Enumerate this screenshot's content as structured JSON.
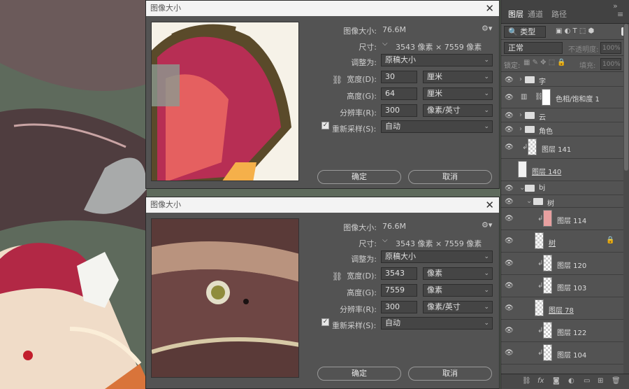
{
  "dialogs": [
    {
      "title": "图像大小",
      "image_size_label": "图像大小:",
      "image_size_value": "76.6M",
      "dimensions_label": "尺寸:",
      "dimensions_value": "3543 像素 × 7559 像素",
      "fit_label": "调整为:",
      "fit_value": "原稿大小",
      "width_label": "宽度(D):",
      "width_value": "30",
      "width_unit": "厘米",
      "height_label": "高度(G):",
      "height_value": "64",
      "height_unit": "厘米",
      "res_label": "分辨率(R):",
      "res_value": "300",
      "res_unit": "像素/英寸",
      "resample_label": "重新采样(S):",
      "resample_value": "自动",
      "ok": "确定",
      "cancel": "取消"
    },
    {
      "title": "图像大小",
      "image_size_label": "图像大小:",
      "image_size_value": "76.6M",
      "dimensions_label": "尺寸:",
      "dimensions_value": "3543 像素 × 7559 像素",
      "fit_label": "调整为:",
      "fit_value": "原稿大小",
      "width_label": "宽度(D):",
      "width_value": "3543",
      "width_unit": "像素",
      "height_label": "高度(G):",
      "height_value": "7559",
      "height_unit": "像素",
      "res_label": "分辨率(R):",
      "res_value": "300",
      "res_unit": "像素/英寸",
      "resample_label": "重新采样(S):",
      "resample_value": "自动",
      "ok": "确定",
      "cancel": "取消"
    }
  ],
  "panel": {
    "tabs": [
      "图层",
      "通道",
      "路径"
    ],
    "kind_placeholder": "类型",
    "blend_mode": "正常",
    "opacity_label": "不透明度:",
    "opacity_value": "100%",
    "lock_label": "锁定:",
    "fill_label": "填充:",
    "fill_value": "100%",
    "layers": [
      {
        "name": "字",
        "type": "group"
      },
      {
        "name": "色相/饱和度 1",
        "type": "adjust"
      },
      {
        "name": "云",
        "type": "group"
      },
      {
        "name": "角色",
        "type": "group"
      },
      {
        "name": "图层 141",
        "type": "layer"
      },
      {
        "name": "图层 140",
        "type": "layer"
      },
      {
        "name": "bj",
        "type": "group"
      },
      {
        "name": "树",
        "type": "group"
      },
      {
        "name": "图层 114",
        "type": "layer"
      },
      {
        "name": "树",
        "type": "layer"
      },
      {
        "name": "图层 120",
        "type": "layer"
      },
      {
        "name": "图层 103",
        "type": "layer"
      },
      {
        "name": "图层 78",
        "type": "layer"
      },
      {
        "name": "图层 122",
        "type": "layer"
      },
      {
        "name": "图层 104",
        "type": "layer"
      }
    ]
  }
}
